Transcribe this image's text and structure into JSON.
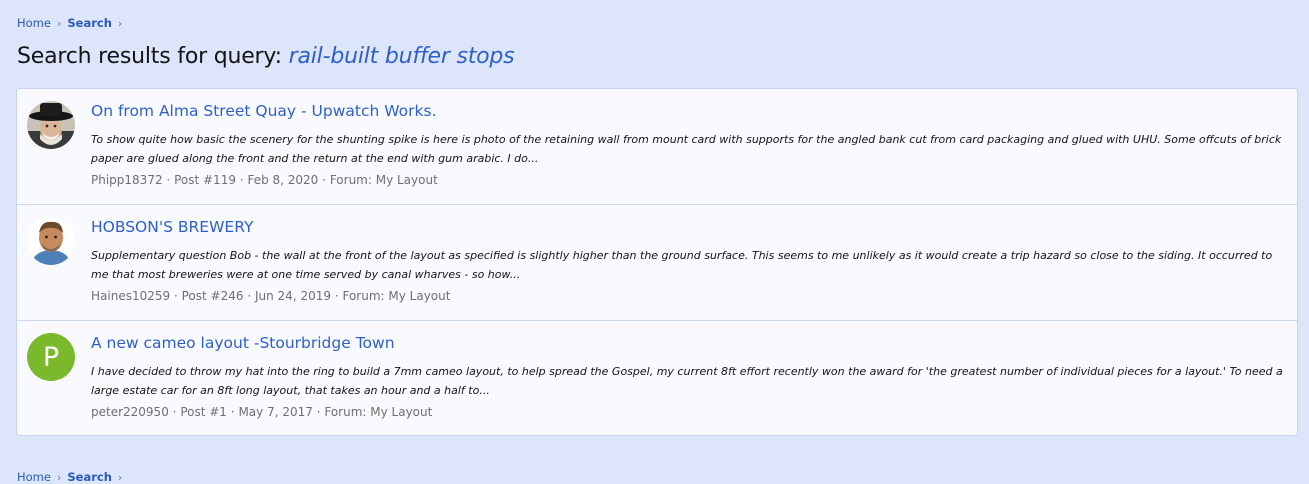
{
  "breadcrumb": {
    "home": "Home",
    "search": "Search",
    "separator": "›"
  },
  "page": {
    "title_prefix": "Search results for query:",
    "query": "rail-built buffer stops"
  },
  "results": [
    {
      "title": "On from Alma Street Quay - Upwatch Works.",
      "snippet": "To show quite how basic the scenery for the shunting spike is here is photo of the retaining wall from mount card with supports for the angled bank cut from card packaging and glued with UHU. Some offcuts of brick paper are glued along the front and the return at the end with gum arabic. I do...",
      "author": "Phipp18372",
      "post": "Post #119",
      "date": "Feb 8, 2020",
      "forum": "Forum: My Layout",
      "avatar": "photo-man-hat"
    },
    {
      "title": "HOBSON'S BREWERY",
      "snippet": "Supplementary question Bob - the wall at the front of the layout as specified is slightly higher than the ground surface. This seems to me unlikely as it would create a trip hazard so close to the siding. It occurred to me that most breweries were at one time served by canal wharves - so how...",
      "author": "Haines10259",
      "post": "Post #246",
      "date": "Jun 24, 2019",
      "forum": "Forum: My Layout",
      "avatar": "photo-man"
    },
    {
      "title": "A new cameo layout -Stourbridge Town",
      "snippet": "I have decided to throw my hat into the ring to build a 7mm cameo layout, to help spread the Gospel, my current 8ft effort recently won the award for 'the greatest number of individual pieces for a layout.' To need a large estate car for an 8ft long layout, that takes an hour and a half to...",
      "author": "peter220950",
      "post": "Post #1",
      "date": "May 7, 2017",
      "forum": "Forum: My Layout",
      "avatar": "letter",
      "avatar_letter": "P"
    }
  ],
  "meta_separator": "·",
  "colors": {
    "background": "#dce5fa",
    "link": "#2f5fc8",
    "avatar_letter_bg": "#7ab82c"
  }
}
